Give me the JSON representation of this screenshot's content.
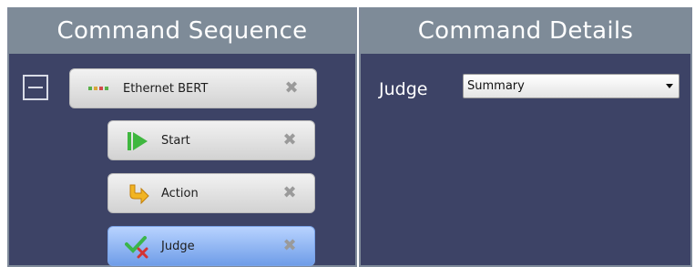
{
  "left_panel": {
    "title": "Command Sequence",
    "items": [
      {
        "label": "Ethernet BERT",
        "icon": "ethernet-ports-icon",
        "selected": false
      },
      {
        "label": "Start",
        "icon": "play-icon",
        "selected": false
      },
      {
        "label": "Action",
        "icon": "arrow-icon",
        "selected": false
      },
      {
        "label": "Judge",
        "icon": "judge-icon",
        "selected": true
      }
    ]
  },
  "right_panel": {
    "title": "Command Details",
    "judge_label": "Judge",
    "judge_select_value": "Summary"
  },
  "colors": {
    "panel_bg": "#3d4366",
    "header_bg": "#7e8b98",
    "selected_item": "#6f9de8"
  }
}
